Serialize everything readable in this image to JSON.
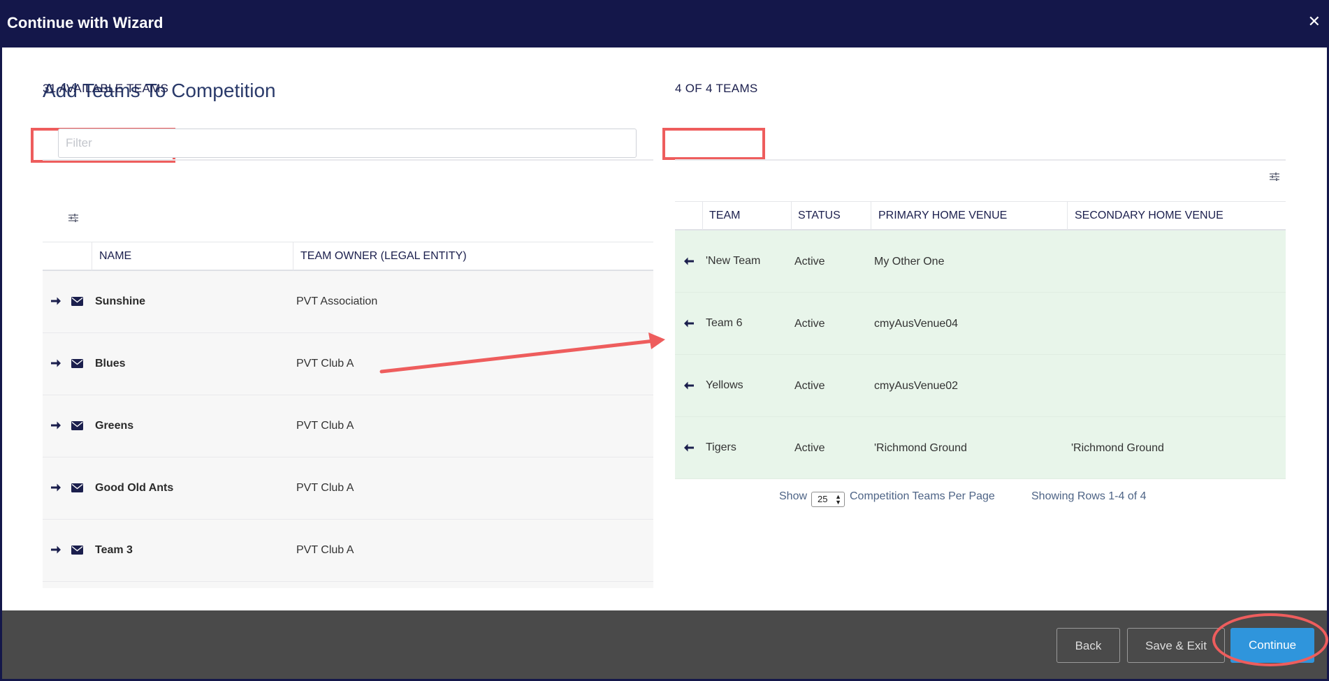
{
  "header": {
    "title": "Continue with Wizard",
    "close_icon": "close-icon"
  },
  "page_title": "Add Teams To Competition",
  "available": {
    "heading": "31 AVAILABLE TEAMS",
    "filter_placeholder": "Filter",
    "columns": [
      "NAME",
      "TEAM OWNER (LEGAL ENTITY)"
    ],
    "rows": [
      {
        "name": "Sunshine",
        "owner": "PVT Association"
      },
      {
        "name": "Blues",
        "owner": "PVT Club A"
      },
      {
        "name": "Greens",
        "owner": "PVT Club A"
      },
      {
        "name": "Good Old Ants",
        "owner": "PVT Club A"
      },
      {
        "name": "Team 3",
        "owner": "PVT Club A"
      }
    ]
  },
  "selected": {
    "heading": "4 OF 4 TEAMS",
    "columns": [
      "TEAM",
      "STATUS",
      "PRIMARY HOME VENUE",
      "SECONDARY HOME VENUE"
    ],
    "rows": [
      {
        "team": "'New Team",
        "status": "Active",
        "primary": "My Other One",
        "secondary": ""
      },
      {
        "team": "Team 6",
        "status": "Active",
        "primary": "cmyAusVenue04",
        "secondary": ""
      },
      {
        "team": "Yellows",
        "status": "Active",
        "primary": "cmyAusVenue02",
        "secondary": ""
      },
      {
        "team": "Tigers",
        "status": "Active",
        "primary": "'Richmond Ground",
        "secondary": "'Richmond Ground"
      }
    ],
    "pager": {
      "show_label": "Show",
      "per_page": "25",
      "per_page_label": "Competition Teams Per Page",
      "showing": "Showing Rows 1-4 of 4"
    }
  },
  "footer": {
    "back": "Back",
    "save_exit": "Save & Exit",
    "continue": "Continue"
  },
  "colors": {
    "header_bg": "#14174a",
    "highlight": "#ee5d5d",
    "selected_row_bg": "#e8f5ea",
    "primary_button": "#2f95dc",
    "footer_bg": "#4a4a4a"
  }
}
